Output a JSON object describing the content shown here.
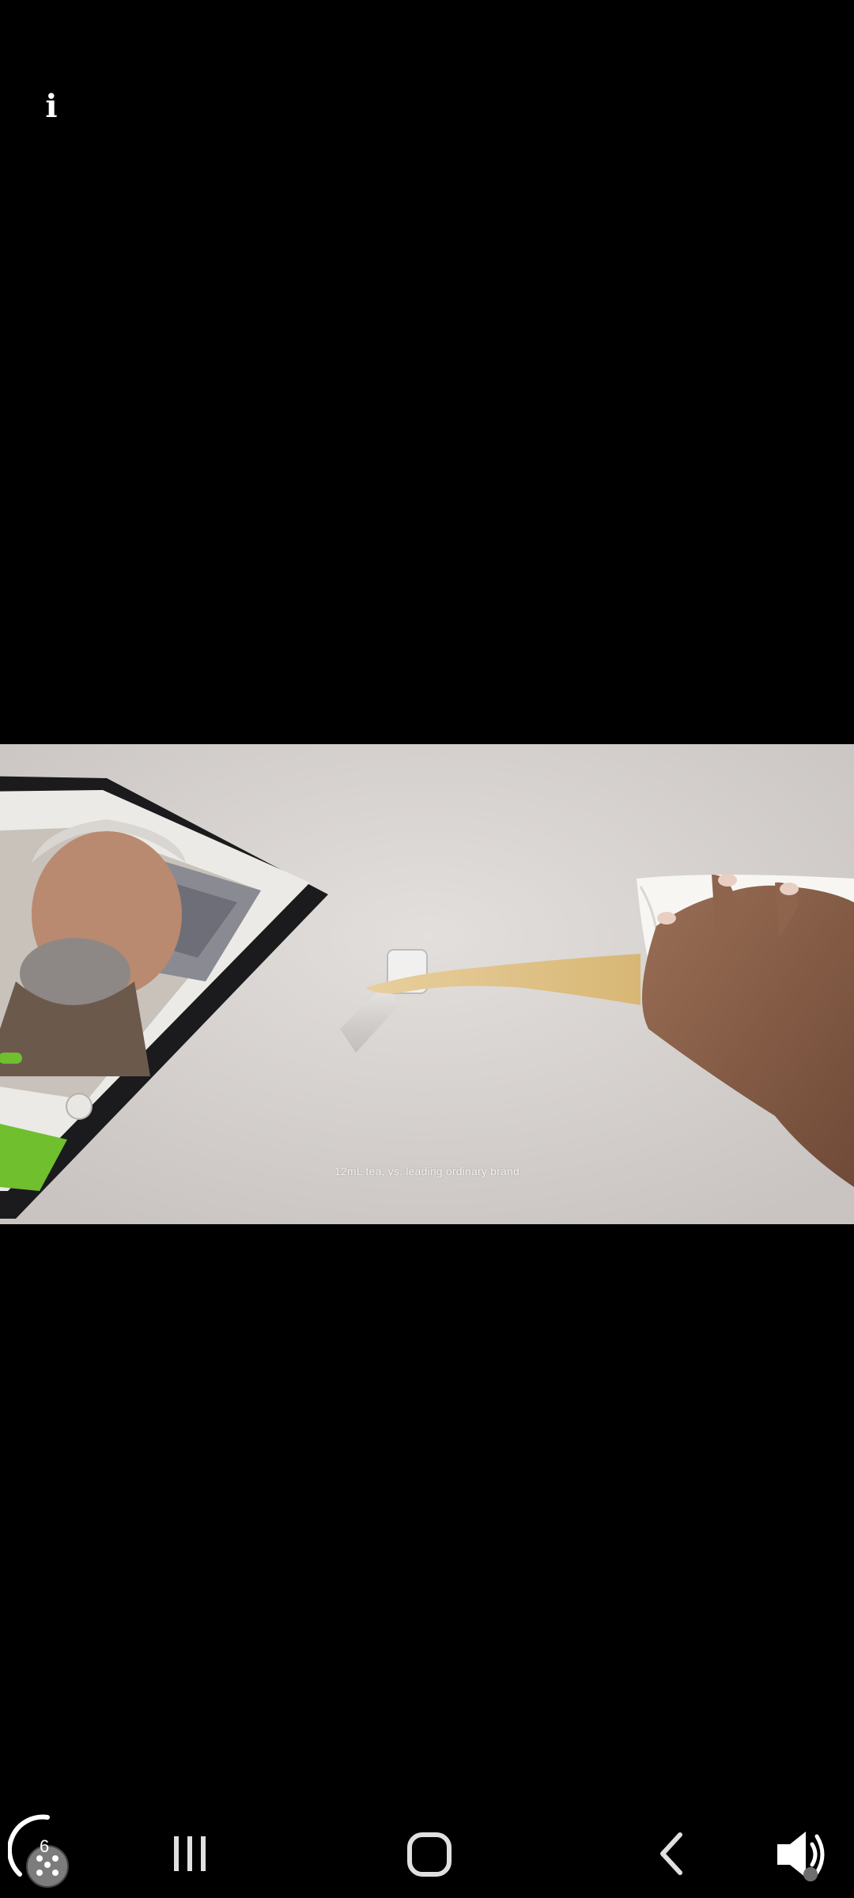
{
  "info_button": {
    "label": "i"
  },
  "video": {
    "caption": "12mL tea, vs. leading ordinary brand"
  },
  "navbar": {
    "game_tools_count": "6",
    "icons": [
      "game-tools-icon",
      "recents-icon",
      "home-icon",
      "back-icon",
      "volume-icon"
    ]
  }
}
